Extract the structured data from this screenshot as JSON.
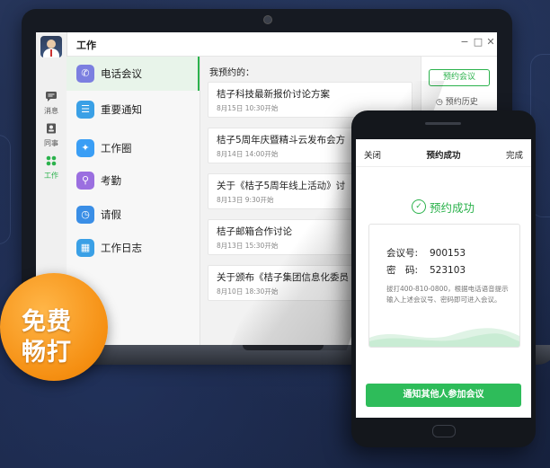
{
  "app": {
    "title": "工作",
    "window_controls": {
      "minimize": "−",
      "maximize": "□",
      "close": "✕"
    }
  },
  "rail": {
    "items": [
      {
        "label": "消息",
        "icon": "chat-icon"
      },
      {
        "label": "同事",
        "icon": "contacts-icon"
      },
      {
        "label": "工作",
        "icon": "apps-icon",
        "active": true
      }
    ]
  },
  "menu": {
    "items": [
      {
        "label": "电话会议",
        "icon": "phone-icon",
        "color": "#7b7fe0",
        "active": true
      },
      {
        "label": "重要通知",
        "icon": "notice-icon",
        "color": "#3aa0e6"
      },
      {
        "label": "工作圈",
        "icon": "compass-icon",
        "color": "#3a9ef5"
      },
      {
        "label": "考勤",
        "icon": "location-icon",
        "color": "#9b6fe0"
      },
      {
        "label": "请假",
        "icon": "clock-icon",
        "color": "#3a8ee6"
      },
      {
        "label": "工作日志",
        "icon": "log-icon",
        "color": "#3aa0e6"
      }
    ]
  },
  "list": {
    "header": "我预约的：",
    "cards": [
      {
        "title": "桔子科技最新报价讨论方案",
        "time": "8月15日 10:30开始"
      },
      {
        "title": "桔子5周年庆暨精斗云发布会方",
        "time": "8月14日 14:00开始"
      },
      {
        "title": "关于《桔子5周年线上活动》讨",
        "time": "8月13日 9:30开始"
      },
      {
        "title": "桔子邮箱合作讨论",
        "time": "8月13日 15:30开始"
      },
      {
        "title": "关于颁布《桔子集团信息化委员",
        "time": "8月10日 18:30开始"
      }
    ]
  },
  "right_panel": {
    "book_button": "预约会议",
    "history_label": "预约历史"
  },
  "badge": {
    "line1": "免费",
    "line2": "畅打"
  },
  "phone": {
    "nav": {
      "close": "关闭",
      "title": "预约成功",
      "done": "完成"
    },
    "success_label": "预约成功",
    "meeting_id_label": "会议号:",
    "meeting_id": "900153",
    "password_label": "密　码:",
    "password": "523103",
    "hint": "拔打400-810-0800，根据电话语音提示输入上述会议号、密码即可进入会议。",
    "cta": "通知其他人参加会议"
  },
  "colors": {
    "accent": "#2bb24c",
    "badge": "#f58f12"
  }
}
